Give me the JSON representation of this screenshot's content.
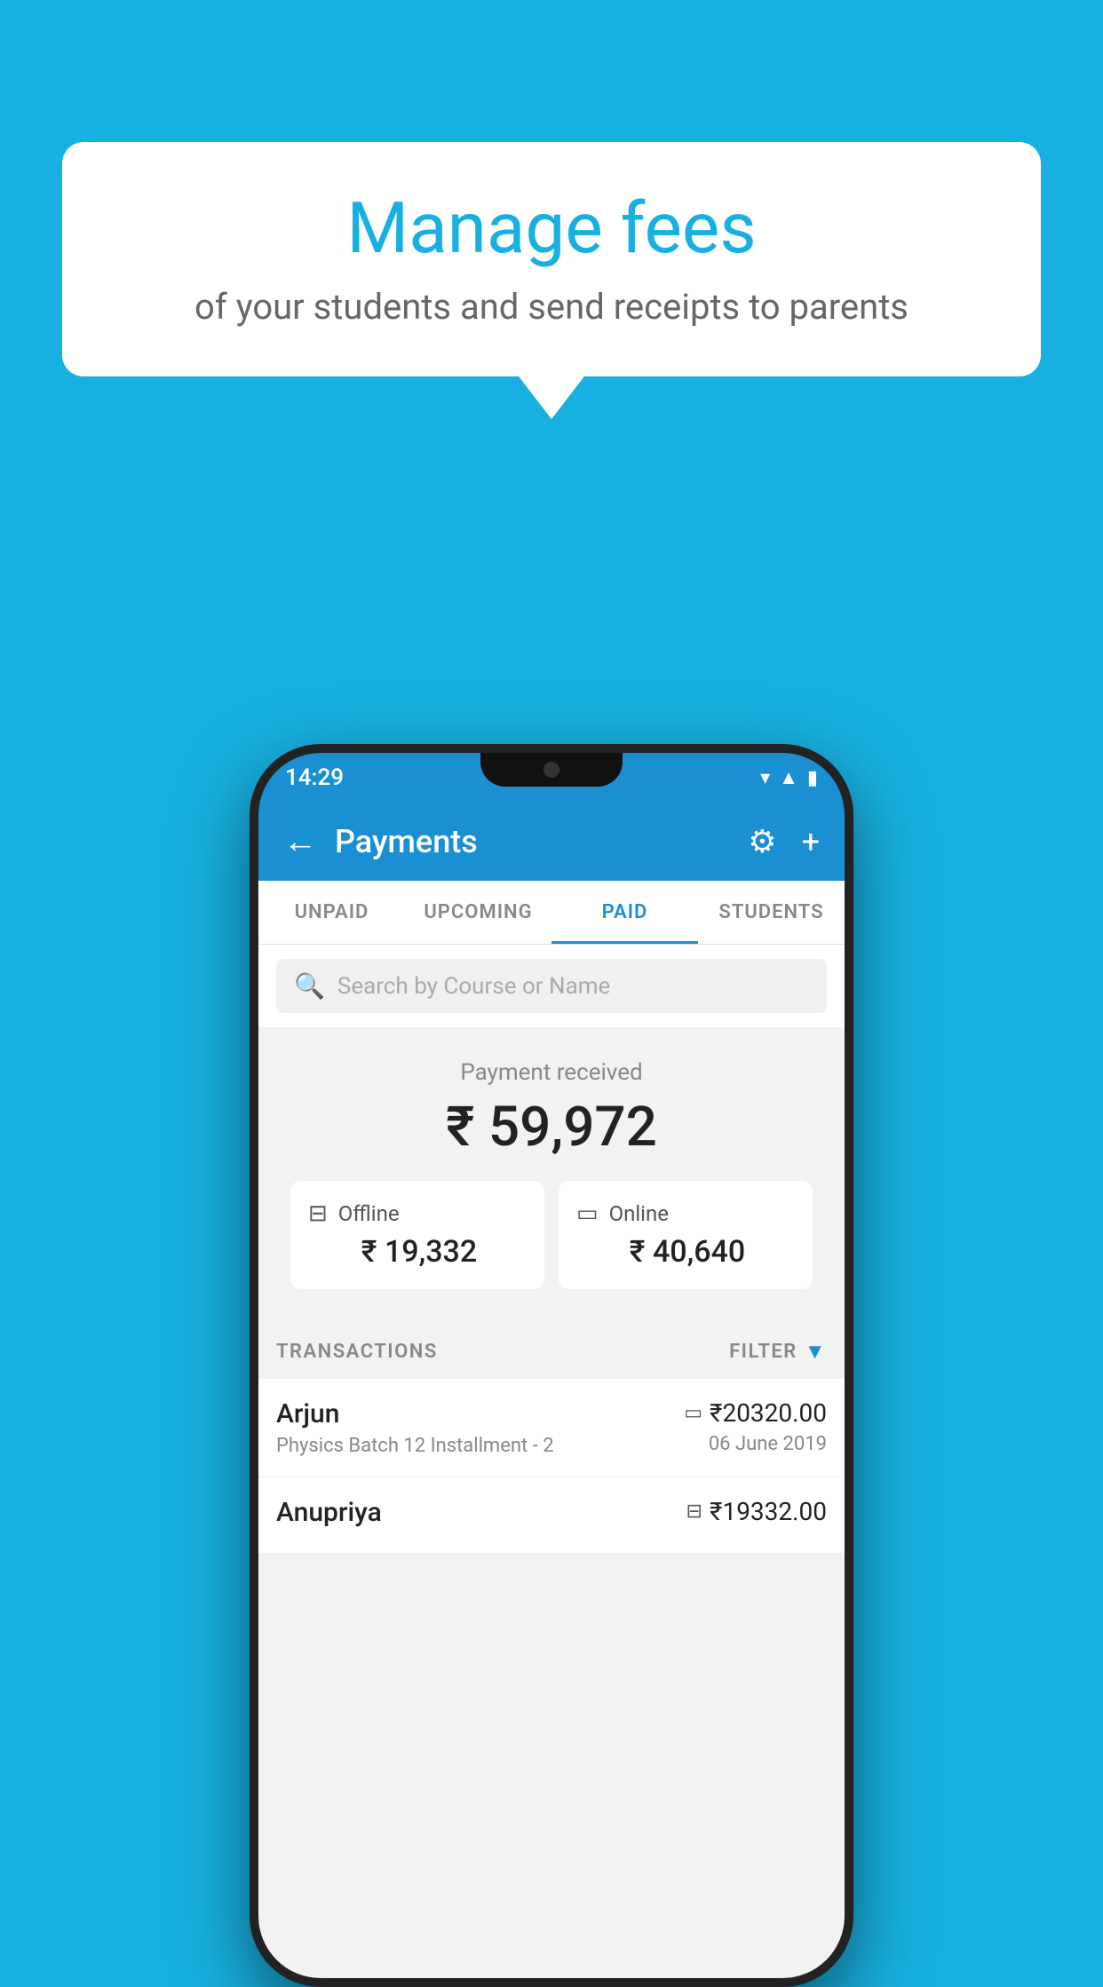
{
  "background_color": "#18b0e0",
  "speech_bubble": {
    "heading": "Manage fees",
    "subtext": "of your students and send receipts to parents"
  },
  "status_bar": {
    "time": "14:29",
    "icons": [
      "wifi",
      "signal",
      "battery"
    ]
  },
  "app_bar": {
    "title": "Payments",
    "back_label": "←",
    "gear_label": "⚙",
    "plus_label": "+"
  },
  "tabs": [
    {
      "label": "UNPAID",
      "active": false
    },
    {
      "label": "UPCOMING",
      "active": false
    },
    {
      "label": "PAID",
      "active": true
    },
    {
      "label": "STUDENTS",
      "active": false
    }
  ],
  "search": {
    "placeholder": "Search by Course or Name"
  },
  "payment_summary": {
    "label": "Payment received",
    "amount": "₹ 59,972",
    "offline": {
      "label": "Offline",
      "amount": "₹ 19,332"
    },
    "online": {
      "label": "Online",
      "amount": "₹ 40,640"
    }
  },
  "transactions_section": {
    "header_label": "TRANSACTIONS",
    "filter_label": "FILTER"
  },
  "transactions": [
    {
      "name": "Arjun",
      "description": "Physics Batch 12 Installment - 2",
      "amount": "₹20320.00",
      "date": "06 June 2019",
      "type": "online"
    },
    {
      "name": "Anupriya",
      "description": "",
      "amount": "₹19332.00",
      "date": "",
      "type": "offline"
    }
  ]
}
